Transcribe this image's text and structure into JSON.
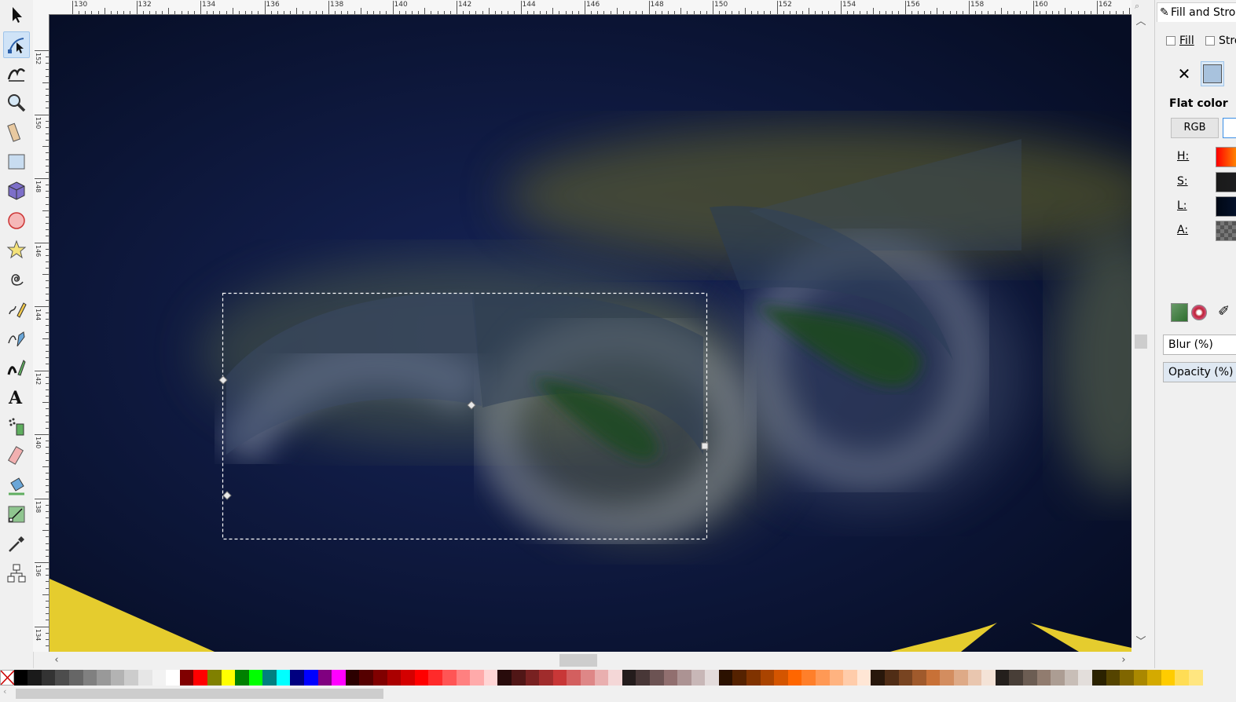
{
  "tools": [
    {
      "name": "selector-tool",
      "icon": "arrow-icon"
    },
    {
      "name": "node-tool",
      "icon": "node-edit-icon",
      "active": true
    },
    {
      "name": "tweak-tool",
      "icon": "tweak-icon"
    },
    {
      "name": "zoom-tool",
      "icon": "magnifier-icon"
    },
    {
      "name": "measure-tool",
      "icon": "ruler-icon"
    },
    {
      "name": "rectangle-tool",
      "icon": "rectangle-icon"
    },
    {
      "name": "3d-box-tool",
      "icon": "cube-icon"
    },
    {
      "name": "ellipse-tool",
      "icon": "circle-icon"
    },
    {
      "name": "star-tool",
      "icon": "star-icon"
    },
    {
      "name": "spiral-tool",
      "icon": "spiral-icon"
    },
    {
      "name": "pencil-tool",
      "icon": "pencil-icon"
    },
    {
      "name": "pen-tool",
      "icon": "pen-icon"
    },
    {
      "name": "calligraphy-tool",
      "icon": "calligraphy-icon"
    },
    {
      "name": "text-tool",
      "icon": "text-icon"
    },
    {
      "name": "spray-tool",
      "icon": "spray-icon"
    },
    {
      "name": "eraser-tool",
      "icon": "eraser-icon"
    },
    {
      "name": "paint-bucket-tool",
      "icon": "bucket-icon"
    },
    {
      "name": "gradient-tool",
      "icon": "gradient-icon"
    },
    {
      "name": "dropper-tool",
      "icon": "dropper-icon"
    },
    {
      "name": "connector-tool",
      "icon": "connector-icon"
    }
  ],
  "ruler": {
    "top_labels": [
      "130",
      "132",
      "134",
      "136",
      "138",
      "140",
      "142",
      "144",
      "146",
      "148",
      "150",
      "152",
      "154",
      "156",
      "158",
      "160",
      "162"
    ],
    "left_labels": [
      "1|5|2",
      "1|5|0",
      "1|4|8",
      "1|4|6",
      "1|4|4",
      "1|4|2",
      "1|4|0",
      "1|3|8",
      "1|3|6",
      "1|3|4"
    ]
  },
  "panel": {
    "title": "Fill and Stroke",
    "tab_fill": "Fill",
    "tab_stroke": "Stroke paint",
    "flat_label": "Flat color",
    "mode_rgb": "RGB",
    "sliders": [
      {
        "label": "H:",
        "gradient": "linear-gradient(90deg,#ff0000,#ff8000,#ffff00)"
      },
      {
        "label": "S:",
        "gradient": "linear-gradient(90deg,#1a1a1a,#1f2024)"
      },
      {
        "label": "L:",
        "gradient": "linear-gradient(90deg,#000814,#0a1a40)"
      },
      {
        "label": "A:",
        "gradient": "repeating-conic-gradient(#777 0% 25%,#555 0% 50%) 0 0/10px 10px"
      }
    ],
    "blur_label": "Blur (%)",
    "opacity_label": "Opacity (%)"
  },
  "palette": [
    "#000000",
    "#1a1a1a",
    "#333333",
    "#4d4d4d",
    "#666666",
    "#808080",
    "#999999",
    "#b3b3b3",
    "#cccccc",
    "#e6e6e6",
    "#f2f2f2",
    "#ffffff",
    "#800000",
    "#ff0000",
    "#808000",
    "#ffff00",
    "#008000",
    "#00ff00",
    "#008080",
    "#00ffff",
    "#000080",
    "#0000ff",
    "#800080",
    "#ff00ff",
    "#2b0000",
    "#550000",
    "#800000",
    "#aa0000",
    "#d40000",
    "#ff0000",
    "#ff2a2a",
    "#ff5555",
    "#ff8080",
    "#ffaaaa",
    "#ffd5d5",
    "#280b0b",
    "#501616",
    "#782121",
    "#a02c2c",
    "#c83737",
    "#d35f5f",
    "#de8787",
    "#e9afaf",
    "#f4d7d7",
    "#241c1c",
    "#483737",
    "#6c5353",
    "#916f6f",
    "#ac9393",
    "#c8b7b7",
    "#e3dbdb",
    "#2b1100",
    "#552200",
    "#803300",
    "#aa4400",
    "#d45500",
    "#ff6600",
    "#ff7f2a",
    "#ff9955",
    "#ffb380",
    "#ffccaa",
    "#ffe6d5",
    "#28170b",
    "#502d16",
    "#784421",
    "#a05a2c",
    "#c87137",
    "#d38d5f",
    "#deaa87",
    "#e9c6af",
    "#f4e3d7",
    "#241f1c",
    "#483e37",
    "#6c5d53",
    "#917c6f",
    "#ac9d93",
    "#c8beb7",
    "#e3dedb",
    "#2b2200",
    "#554400",
    "#806600",
    "#aa8800",
    "#d4aa00",
    "#ffcc00",
    "#ffdd55",
    "#ffe680"
  ],
  "colors": {
    "canvas_bg": "#0c1633",
    "accent": "#9ec4ea",
    "fill_swatch": "#a8c2dd"
  }
}
